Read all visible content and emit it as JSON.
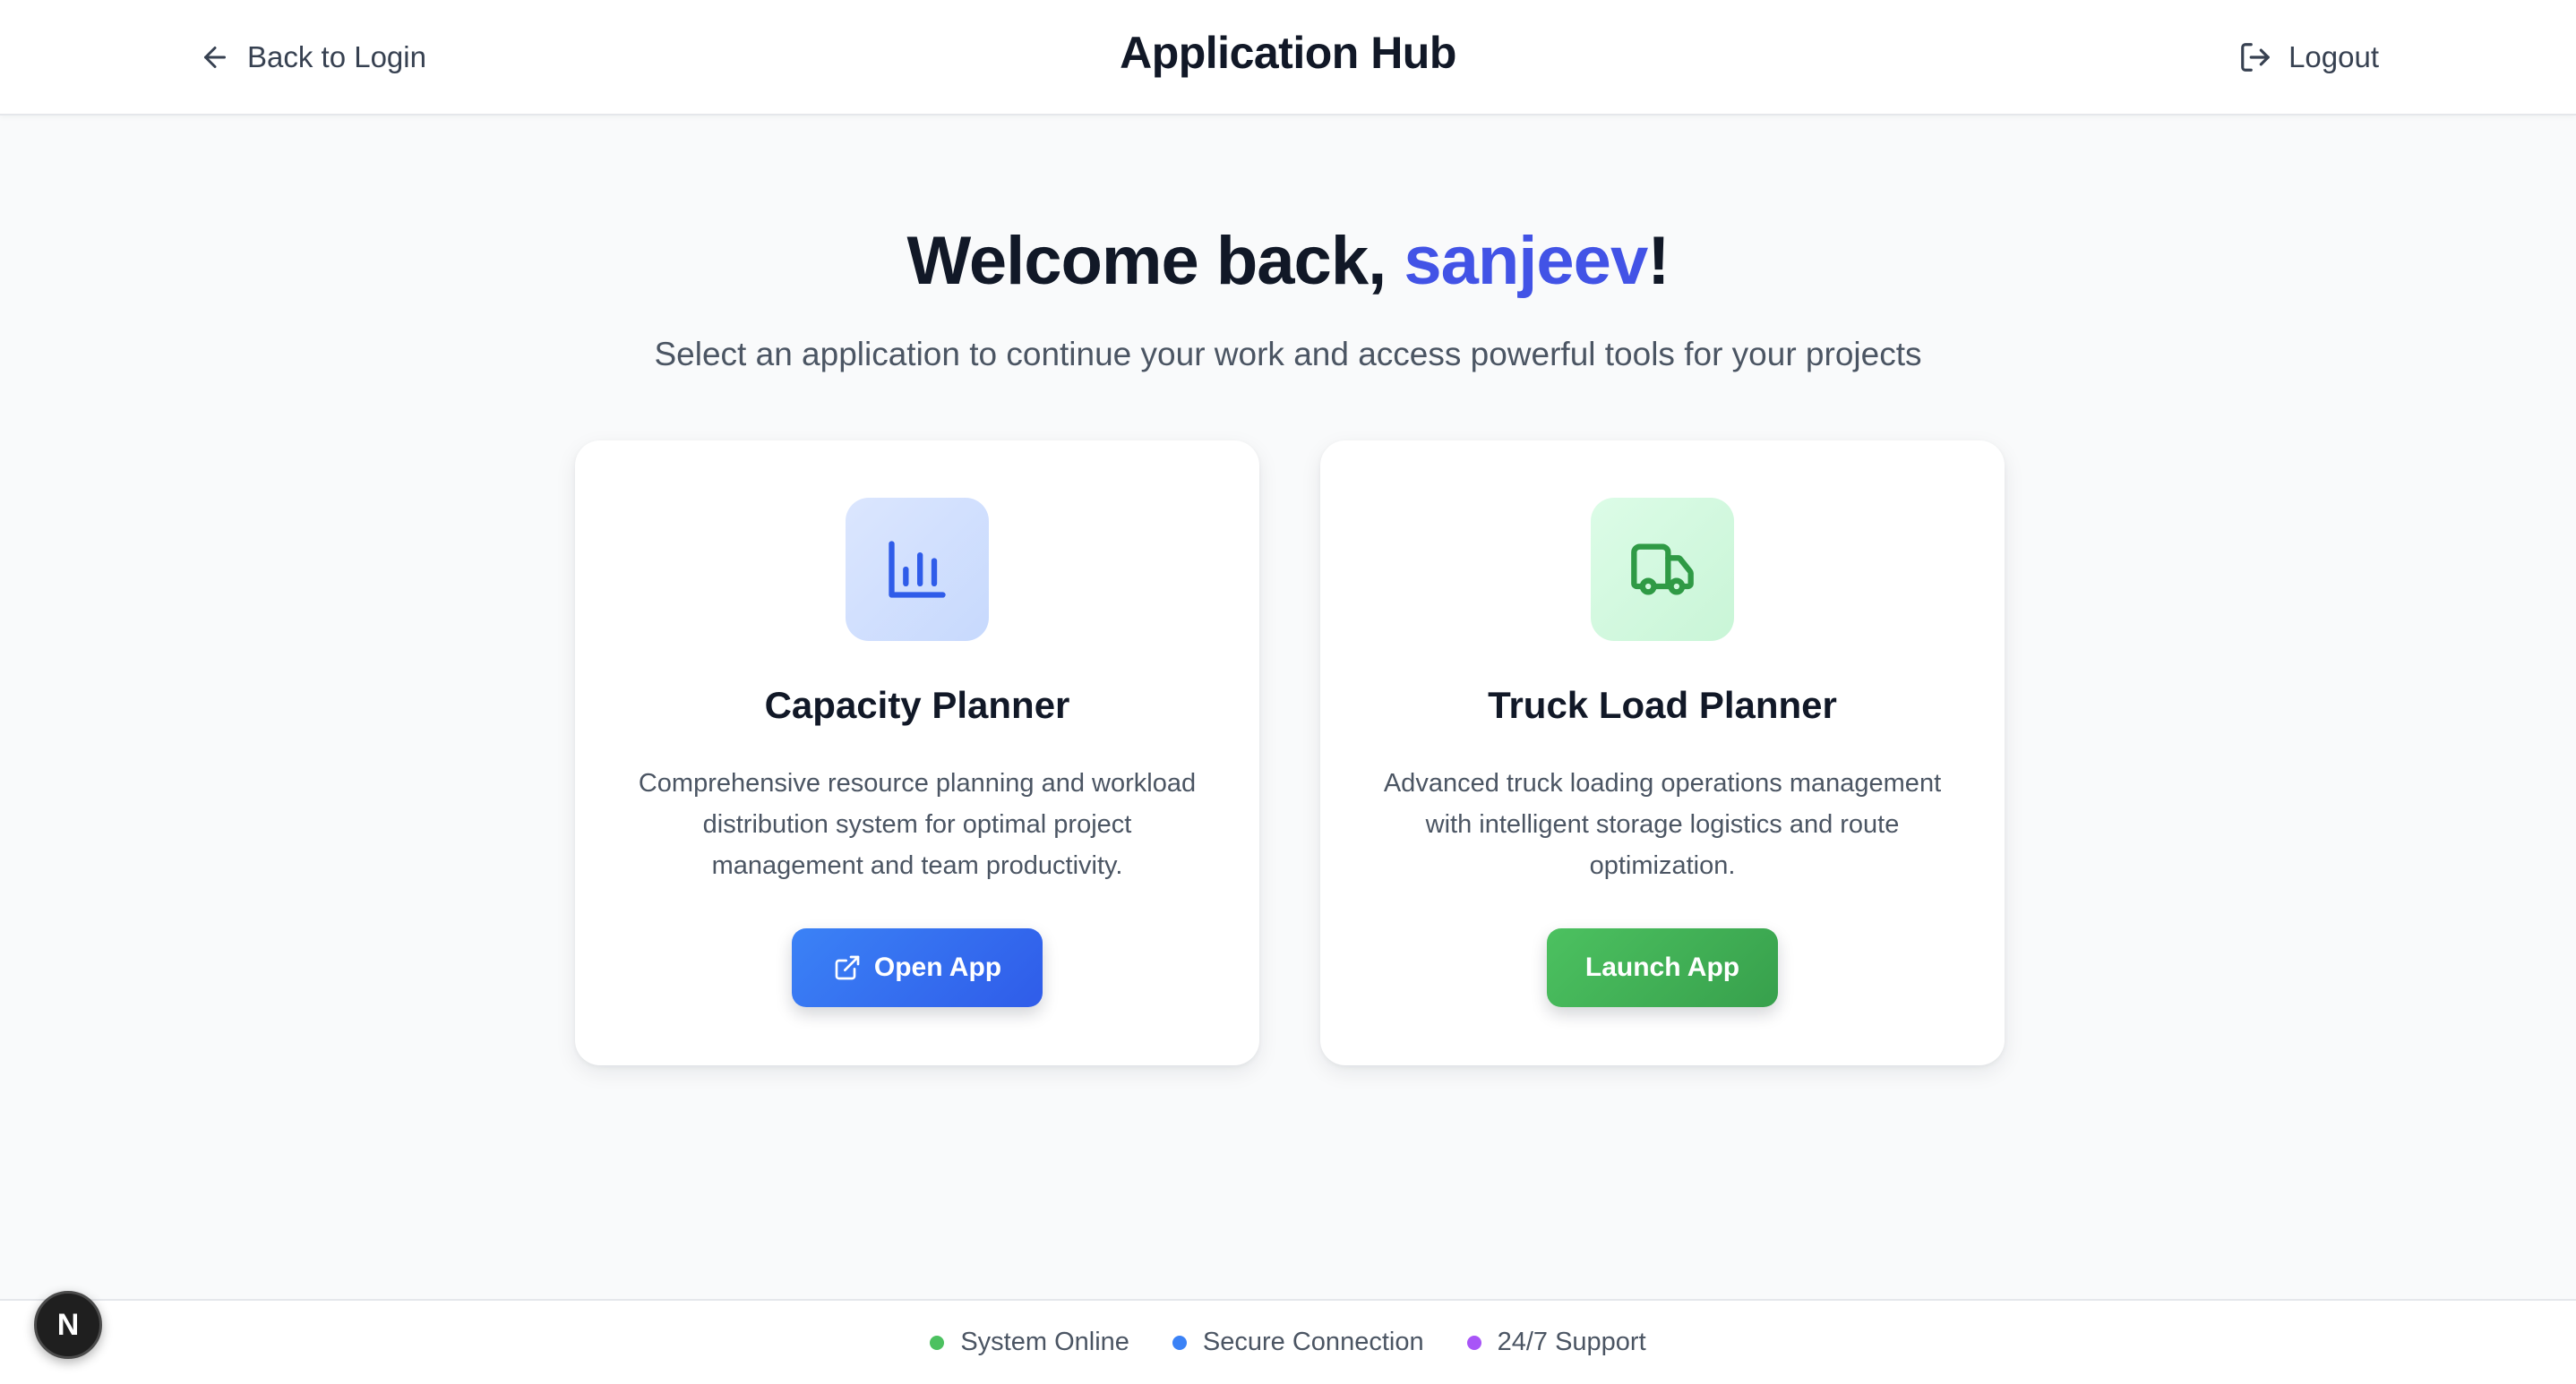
{
  "header": {
    "back_label": "Back to Login",
    "title": "Application Hub",
    "logout_label": "Logout"
  },
  "welcome": {
    "prefix": "Welcome back, ",
    "username": "sanjeev",
    "suffix": "!",
    "subtitle": "Select an application to continue your work and access powerful tools for your projects"
  },
  "apps": [
    {
      "title": "Capacity Planner",
      "description": "Comprehensive resource planning and workload distribution system for optimal project management and team productivity.",
      "button_label": "Open App",
      "icon": "bar-chart-icon",
      "accent": "#3b82f6"
    },
    {
      "title": "Truck Load Planner",
      "description": "Advanced truck loading operations management with intelligent storage logistics and route optimization.",
      "button_label": "Launch App",
      "icon": "truck-icon",
      "accent": "#43b257"
    }
  ],
  "footer": {
    "items": [
      {
        "label": "System Online",
        "color": "#4cc160"
      },
      {
        "label": "Secure Connection",
        "color": "#3b82f6"
      },
      {
        "label": "24/7 Support",
        "color": "#a855f7"
      }
    ]
  },
  "badge": {
    "label": "N"
  }
}
